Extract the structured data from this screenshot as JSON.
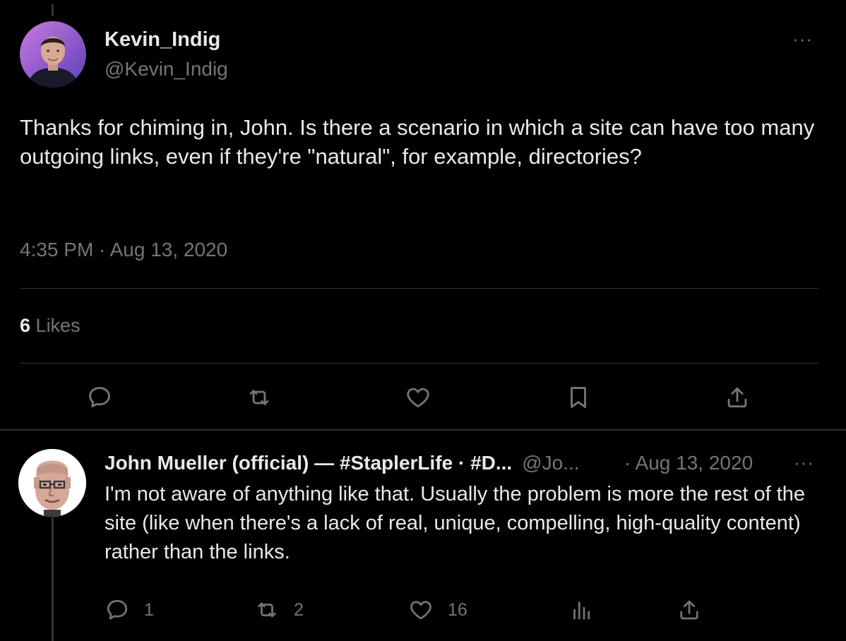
{
  "main_tweet": {
    "author_name": "Kevin_Indig",
    "author_handle": "@Kevin_Indig",
    "more_label": "···",
    "text": "Thanks for chiming in, John. Is there a scenario in which a site can have too many outgoing links, even if they're \"natural\", for example, directories?",
    "timestamp": "4:35 PM · Aug 13, 2020",
    "likes_count": "6",
    "likes_label": "Likes",
    "actions": [
      "reply-icon",
      "retweet-icon",
      "like-icon",
      "bookmark-icon",
      "share-icon"
    ]
  },
  "reply": {
    "author_name": "John Mueller (official) — #StaplerLife · #D...",
    "author_handle": "@Jo...",
    "date": "· Aug 13, 2020",
    "more_label": "···",
    "text": "I'm not aware of anything like that. Usually the problem is more the rest of the site (like when there's a lack of real, unique, compelling, high-quality content) rather than the links.",
    "reply_count": "1",
    "retweet_count": "2",
    "like_count": "16"
  },
  "colors": {
    "background": "#000000",
    "text_primary": "#e7e9ea",
    "text_secondary": "#71767b",
    "divider": "#2f3336",
    "avatar_main_bg": "#8a5fd6"
  }
}
